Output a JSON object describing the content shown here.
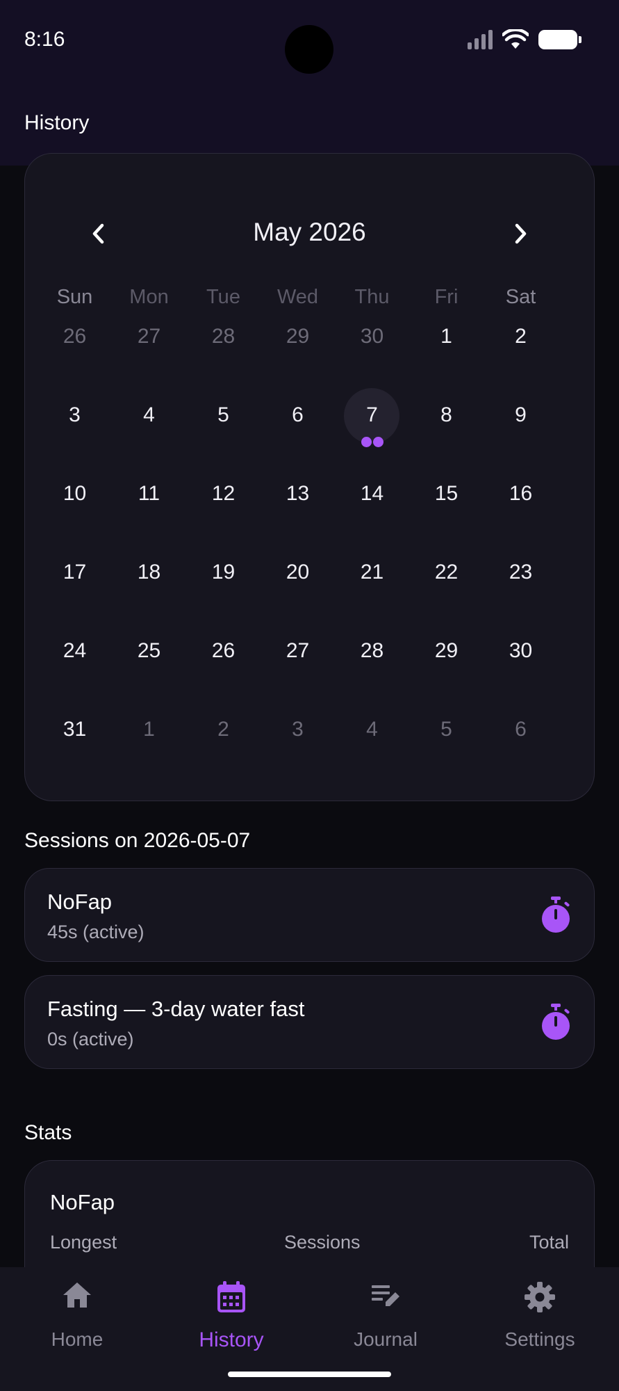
{
  "status_bar": {
    "time": "8:16"
  },
  "app_bar": {
    "title": "History"
  },
  "calendar": {
    "month_label": "May 2026",
    "weekdays": [
      "Sun",
      "Mon",
      "Tue",
      "Wed",
      "Thu",
      "Fri",
      "Sat"
    ],
    "weeks": [
      [
        "26",
        "27",
        "28",
        "29",
        "30",
        "1",
        "2"
      ],
      [
        "3",
        "4",
        "5",
        "6",
        "7",
        "8",
        "9"
      ],
      [
        "10",
        "11",
        "12",
        "13",
        "14",
        "15",
        "16"
      ],
      [
        "17",
        "18",
        "19",
        "20",
        "21",
        "22",
        "23"
      ],
      [
        "24",
        "25",
        "26",
        "27",
        "28",
        "29",
        "30"
      ],
      [
        "31",
        "1",
        "2",
        "3",
        "4",
        "5",
        "6"
      ]
    ],
    "selected_day": "7",
    "selected_day_session_dots": 2
  },
  "sessions": {
    "heading": "Sessions on 2026-05-07",
    "items": [
      {
        "name": "NoFap",
        "detail": "45s (active)",
        "icon": "timer-icon"
      },
      {
        "name": "Fasting — 3-day water fast",
        "detail": "0s (active)",
        "icon": "timer-icon"
      }
    ]
  },
  "stats": {
    "heading": "Stats",
    "card": {
      "name": "NoFap",
      "labels": [
        "Longest",
        "Sessions",
        "Total"
      ]
    }
  },
  "bottom_nav": {
    "items": [
      {
        "label": "Home",
        "icon": "home-icon"
      },
      {
        "label": "History",
        "icon": "calendar-icon"
      },
      {
        "label": "Journal",
        "icon": "journal-edit-icon"
      },
      {
        "label": "Settings",
        "icon": "gear-icon"
      }
    ],
    "active": "History"
  },
  "colors": {
    "accent": "#a855f7",
    "background": "#0b0b10",
    "card": "#16151f",
    "app_bar": "#140f24"
  }
}
